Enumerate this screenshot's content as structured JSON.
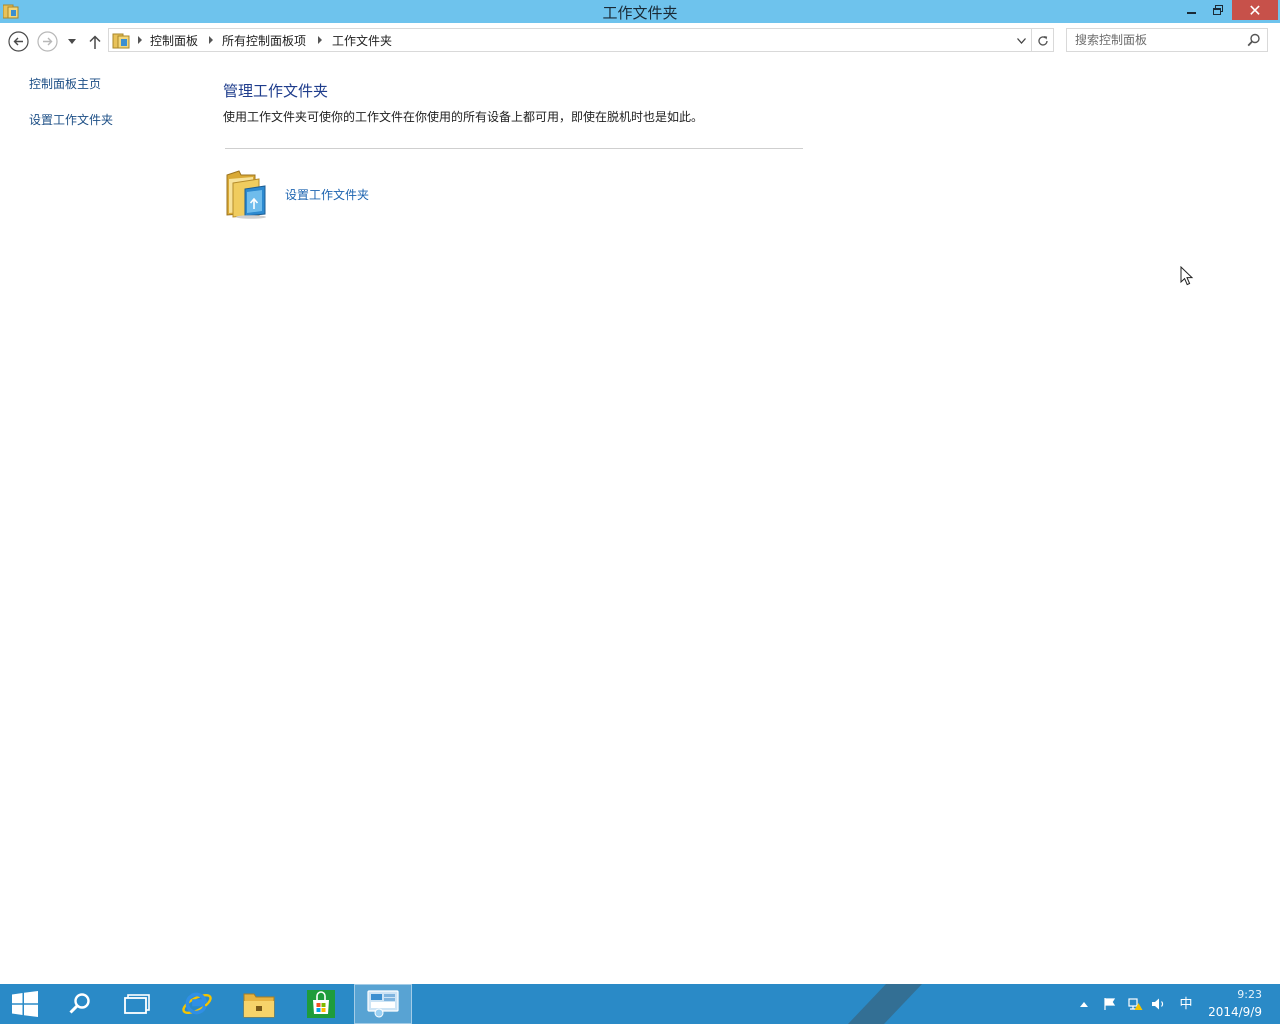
{
  "window": {
    "title": "工作文件夹",
    "close_glyph": "✕"
  },
  "navbar": {
    "breadcrumb": [
      "控制面板",
      "所有控制面板项",
      "工作文件夹"
    ],
    "search_placeholder": "搜索控制面板"
  },
  "sidebar": {
    "items": [
      {
        "label": "控制面板主页"
      },
      {
        "label": "设置工作文件夹"
      }
    ]
  },
  "main": {
    "title": "管理工作文件夹",
    "description": "使用工作文件夹可使你的工作文件在你使用的所有设备上都可用，即使在脱机时也是如此。",
    "items": [
      {
        "label": "设置工作文件夹",
        "icon": "work-folders-icon"
      }
    ]
  },
  "taskbar": {
    "pinned": [
      "start-icon",
      "search-icon",
      "task-view-icon",
      "internet-explorer-icon",
      "file-explorer-icon",
      "store-icon",
      "control-panel-icon"
    ],
    "active": "control-panel-icon",
    "tray": {
      "language": "中",
      "time": "9:23",
      "date": "2014/9/9"
    }
  },
  "colors": {
    "titlebar": "#6ec3ed",
    "close_button": "#c7514a",
    "taskbar": "#2a8ac7",
    "link": "#1d64b0",
    "heading": "#1e3c8c"
  }
}
